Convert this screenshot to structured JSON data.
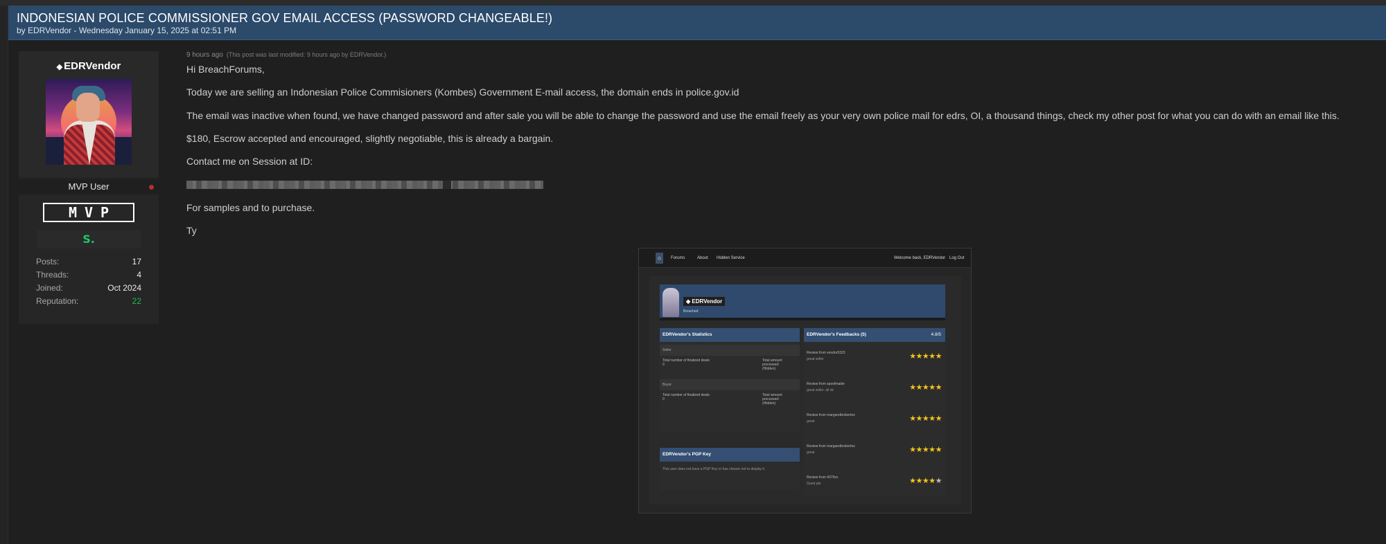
{
  "thread": {
    "title": "INDONESIAN POLICE COMMISSIONER GOV EMAIL ACCESS (PASSWORD CHANGEABLE!)",
    "byline": "by EDRVendor - Wednesday January 15, 2025 at 02:51 PM"
  },
  "author": {
    "gem_icon": "gem-icon",
    "name": "EDRVendor",
    "rank": "MVP User",
    "mvp_badge": "MVP",
    "s_badge": "S.",
    "stats": [
      {
        "label": "Posts:",
        "value": "17"
      },
      {
        "label": "Threads:",
        "value": "4"
      },
      {
        "label": "Joined:",
        "value": "Oct 2024"
      },
      {
        "label": "Reputation:",
        "value": "22"
      }
    ],
    "reputation_color": "#1db954"
  },
  "post": {
    "time": "9 hours ago",
    "modified": "(This post was last modified: 9 hours ago by EDRVendor.)",
    "lines": [
      "Hi BreachForums,",
      "Today we are selling an Indonesian Police Commisioners (Kombes) Government E-mail access, the domain ends in police.gov.id",
      "The email was inactive when found, we have changed password and after sale you will be able to change the password and use the email freely as your very own police mail for edrs, OI, a thousand things, check my other post for what you can do with an email like this.",
      "$180, Escrow accepted and encouraged, slightly negotiable, this is already a bargain.",
      "Contact me on Session at ID:",
      "For samples and to purchase.",
      "Ty"
    ]
  },
  "screenshot": {
    "nav": {
      "home_icon": "home-icon",
      "links": [
        "Forums",
        "About",
        "Hidden Service"
      ],
      "welcome": "Welcome back, EDRVendor",
      "logout": "Log Out"
    },
    "profile": {
      "name": "EDRVendor",
      "group": "Breached"
    },
    "stats_panel": {
      "title": "EDRVendor's Statistics",
      "seller_label": "Seller",
      "buyer_label": "Buyer",
      "deals_label": "Total number of finalized deals:",
      "deals_value": "0",
      "amount_label": "Total amount processed:",
      "amount_value": "(Hidden)"
    },
    "pgp_panel": {
      "title": "EDRVendor's PGP Key",
      "note": "This user does not have a PGP Key or has chosen not to display it."
    },
    "feedback": {
      "title": "EDRVendor's Feedbacks (5)",
      "score": "4.8/5",
      "reviews": [
        {
          "from": "Review from vendor5323",
          "text": "great seller",
          "rating": 5
        },
        {
          "from": "Review from spoofmailer",
          "text": "great seller. all ok",
          "rating": 5
        },
        {
          "from": "Review from margaretbrokerlox",
          "text": "great",
          "rating": 5
        },
        {
          "from": "Review from margaretbrokerlox",
          "text": "great",
          "rating": 5
        },
        {
          "from": "Review from 4079xx",
          "text": "Good job",
          "rating": 4
        }
      ]
    }
  }
}
